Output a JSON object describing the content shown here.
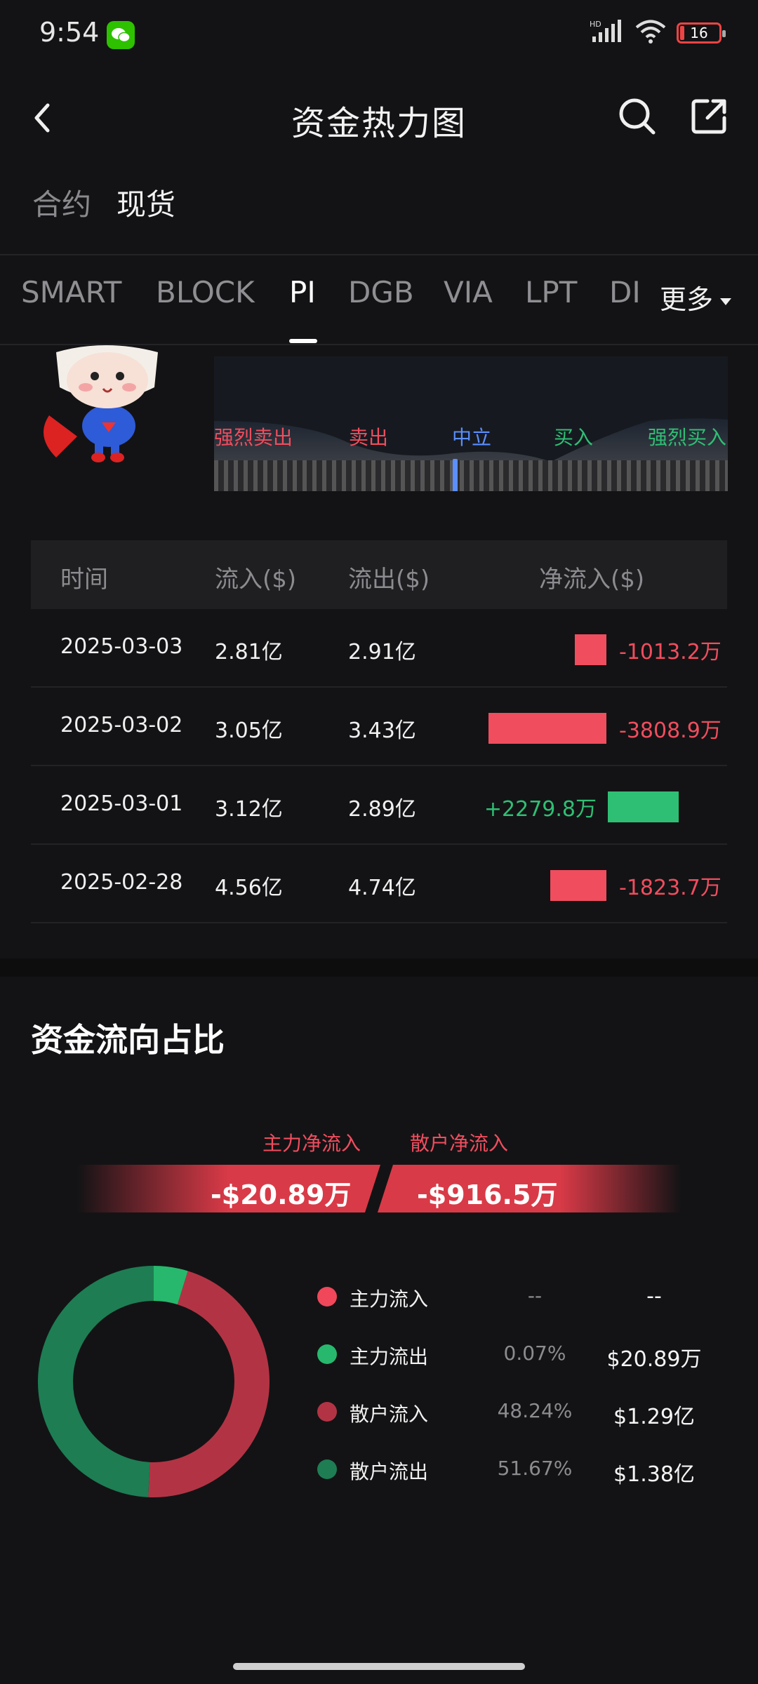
{
  "status_bar": {
    "time": "9:54",
    "battery": "16",
    "network": "HD"
  },
  "header": {
    "title": "资金热力图"
  },
  "segments": [
    "合约",
    "现货"
  ],
  "tabs": [
    "SMART",
    "BLOCK",
    "PI",
    "DGB",
    "VIA",
    "LPT",
    "DI"
  ],
  "active_tab": "PI",
  "more_label": "更多",
  "sentiment": {
    "labels": [
      "强烈卖出",
      "卖出",
      "中立",
      "买入",
      "强烈买入"
    ],
    "level": "中立"
  },
  "table": {
    "headers": [
      "时间",
      "流入($)",
      "流出($)",
      "净流入($)"
    ],
    "rows": [
      {
        "date": "2025-03-03",
        "inflow": "2.81亿",
        "outflow": "2.91亿",
        "net": "-1013.2万",
        "net_value": -1013.2
      },
      {
        "date": "2025-03-02",
        "inflow": "3.05亿",
        "outflow": "3.43亿",
        "net": "-3808.9万",
        "net_value": -3808.9
      },
      {
        "date": "2025-03-01",
        "inflow": "3.12亿",
        "outflow": "2.89亿",
        "net": "+2279.8万",
        "net_value": 2279.8
      },
      {
        "date": "2025-02-28",
        "inflow": "4.56亿",
        "outflow": "4.74亿",
        "net": "-1823.7万",
        "net_value": -1823.7
      }
    ]
  },
  "flow": {
    "title": "资金流向占比",
    "main_net_label": "主力净流入",
    "retail_net_label": "散户净流入",
    "main_net_value": "-$20.89万",
    "retail_net_value": "-$916.5万",
    "legend": [
      {
        "name": "主力流入",
        "pct": "--",
        "amount": "--",
        "color": "#f0475a"
      },
      {
        "name": "主力流出",
        "pct": "0.07%",
        "amount": "$20.89万",
        "color": "#27b86d"
      },
      {
        "name": "散户流入",
        "pct": "48.24%",
        "amount": "$1.29亿",
        "color": "#b23444"
      },
      {
        "name": "散户流出",
        "pct": "51.67%",
        "amount": "$1.38亿",
        "color": "#1e7d53"
      }
    ]
  },
  "colors": {
    "negative": "#f04d5e",
    "positive": "#2fbf74",
    "background": "#131315"
  }
}
